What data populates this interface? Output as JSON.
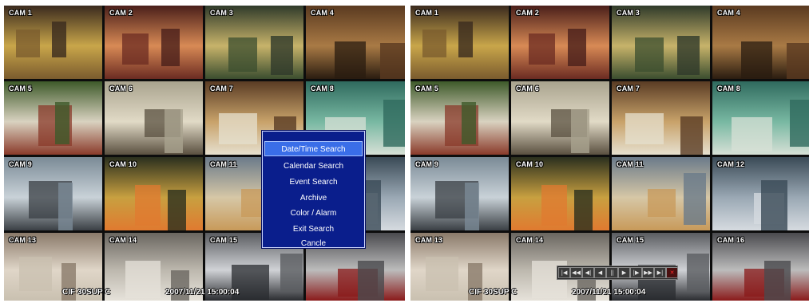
{
  "panels": [
    {
      "cameras": [
        "CAM 1",
        "CAM 2",
        "CAM 3",
        "CAM 4",
        "CAM 5",
        "CAM 6",
        "CAM 7",
        "CAM 8",
        "CAM 9",
        "CAM 10",
        "CAM 11",
        "CAM 12",
        "CAM 13",
        "CAM 14",
        "CAM 15",
        "CAM 16"
      ],
      "status": {
        "resolution": "CIF 30SUP C",
        "datetime": "2007/11/21 15:00:04"
      },
      "search_menu": {
        "items": [
          "Date/Time Search",
          "Calendar Search",
          "Event Search",
          "Archive",
          "Color / Alarm",
          "Exit Search",
          "Cancle"
        ],
        "selected_index": 0
      }
    },
    {
      "cameras": [
        "CAM 1",
        "CAM 2",
        "CAM 3",
        "CAM 4",
        "CAM 5",
        "CAM 6",
        "CAM 7",
        "CAM 8",
        "CAM 9",
        "CAM 10",
        "CAM 11",
        "CAM 12",
        "CAM 13",
        "CAM 14",
        "CAM 15",
        "CAM 16"
      ],
      "status": {
        "resolution": "CIF 30SUP C",
        "datetime": "2007/11/21 15:00:04"
      },
      "playback_controls": [
        {
          "name": "skip-to-start",
          "glyph": "|◀"
        },
        {
          "name": "fast-rewind",
          "glyph": "◀◀"
        },
        {
          "name": "step-back",
          "glyph": "◀|"
        },
        {
          "name": "reverse-play",
          "glyph": "◀"
        },
        {
          "name": "pause",
          "glyph": "||"
        },
        {
          "name": "play",
          "glyph": "▶"
        },
        {
          "name": "step-forward",
          "glyph": "|▶"
        },
        {
          "name": "fast-forward",
          "glyph": "▶▶"
        },
        {
          "name": "skip-to-end",
          "glyph": "▶|"
        },
        {
          "name": "stop",
          "glyph": "✕"
        }
      ]
    }
  ],
  "colors": {
    "menu_bg": "#0a1e8c",
    "menu_selected": "#3a6ee8",
    "label_text": "#ffffff",
    "stop_red": "#ff2a2a"
  }
}
